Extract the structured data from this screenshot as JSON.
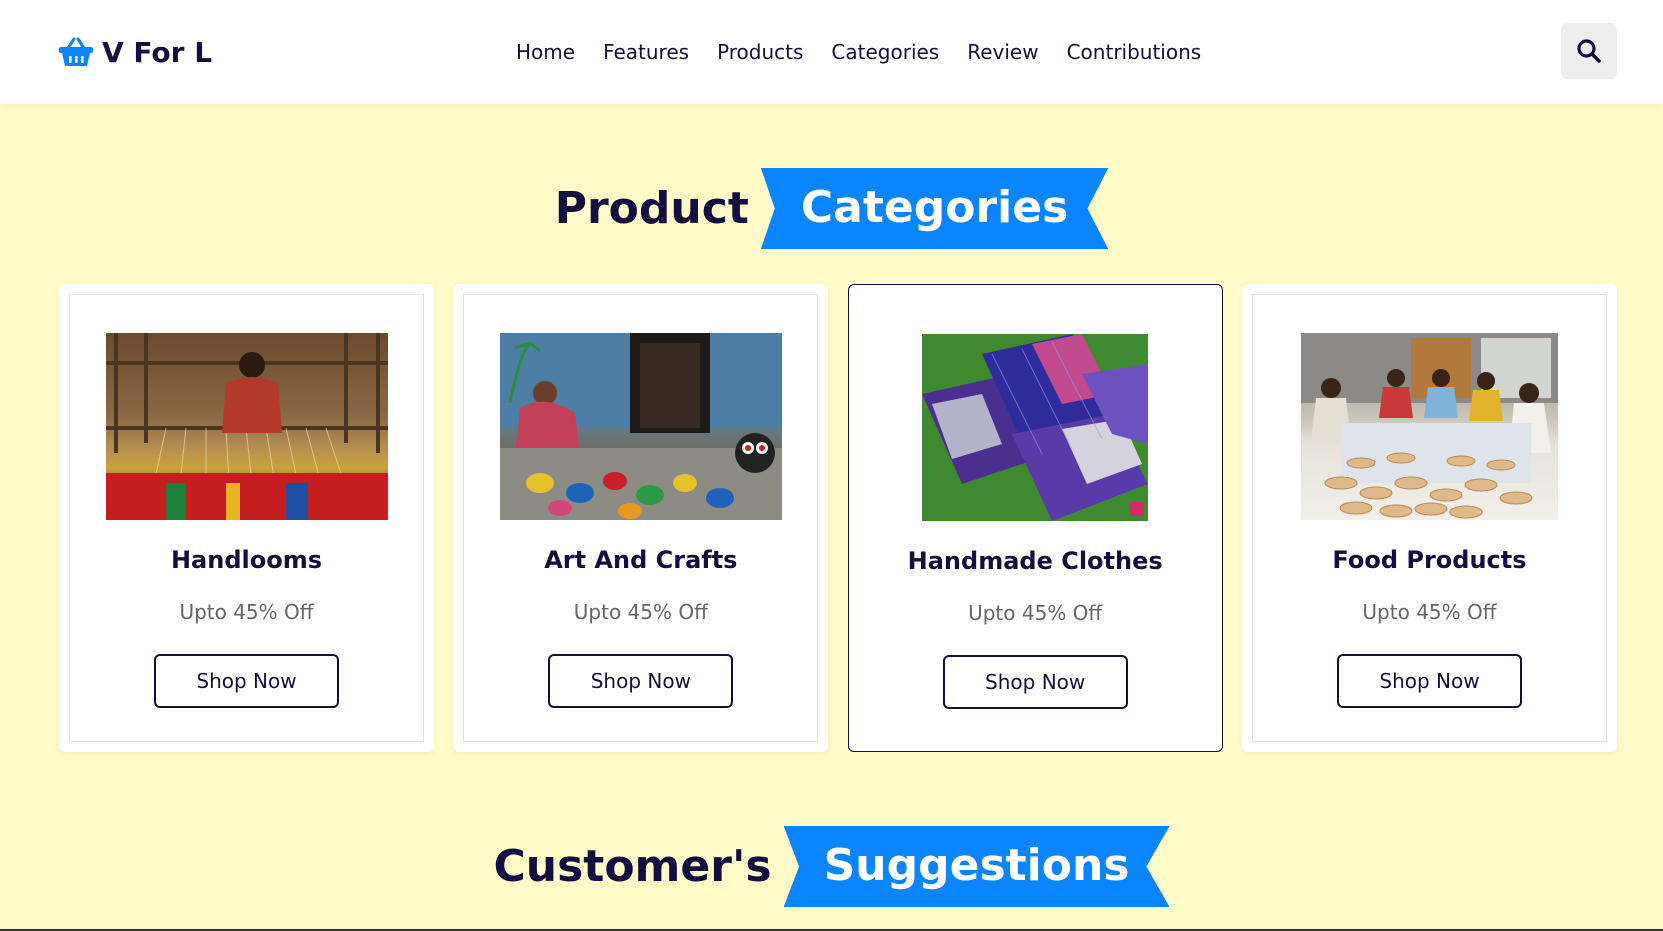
{
  "header": {
    "logo_text": "V For L",
    "logo_icon": "basket-icon",
    "nav": [
      "Home",
      "Features",
      "Products",
      "Categories",
      "Review",
      "Contributions"
    ],
    "search_icon": "search-icon"
  },
  "categories_section": {
    "heading_plain": "Product",
    "heading_highlight": "Categories",
    "cards": [
      {
        "title": "Handlooms",
        "discount": "Upto 45% Off",
        "button": "Shop Now",
        "image": "handloom-weaver-image"
      },
      {
        "title": "Art And Crafts",
        "discount": "Upto 45% Off",
        "button": "Shop Now",
        "image": "painted-toys-image"
      },
      {
        "title": "Handmade Clothes",
        "discount": "Upto 45% Off",
        "button": "Shop Now",
        "image": "silk-sarees-image"
      },
      {
        "title": "Food Products",
        "discount": "Upto 45% Off",
        "button": "Shop Now",
        "image": "papad-makers-image"
      }
    ]
  },
  "suggestions_section": {
    "heading_plain": "Customer's",
    "heading_highlight": "Suggestions"
  },
  "colors": {
    "page_background": "#fffbc9",
    "accent_blue": "#0a84ff",
    "text_dark": "#130f40",
    "text_muted": "#666666"
  }
}
